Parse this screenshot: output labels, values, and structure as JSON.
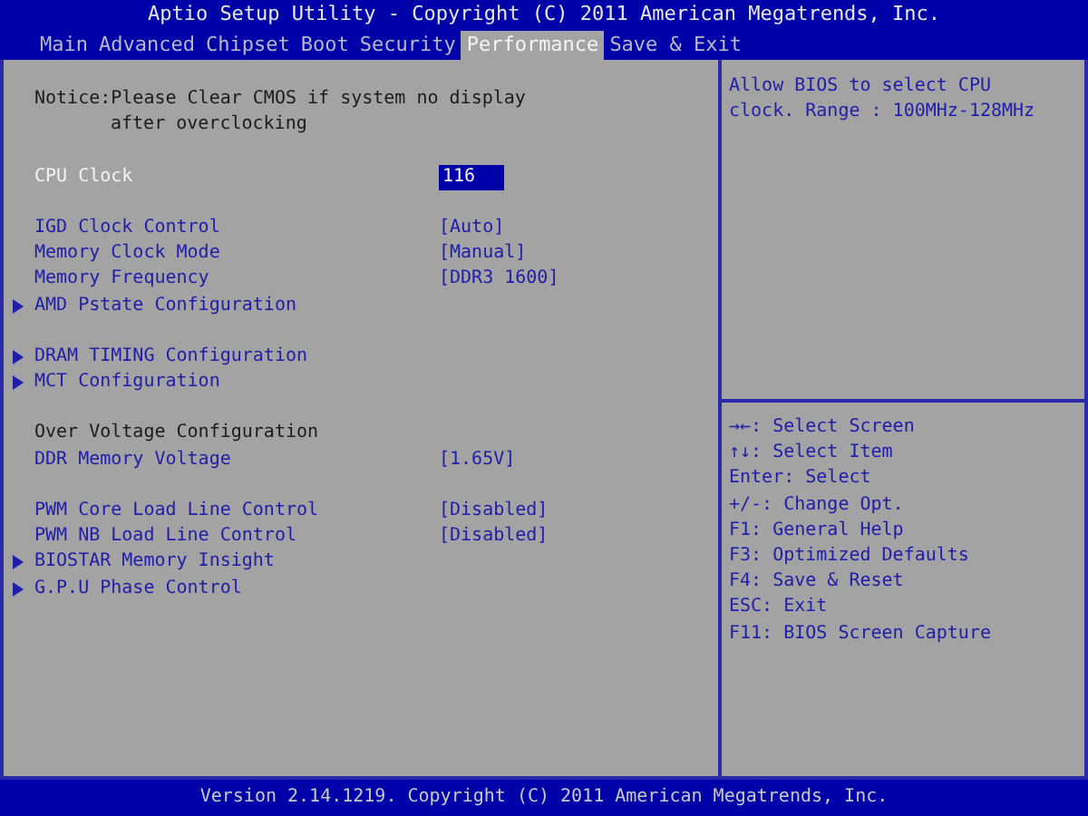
{
  "title": "Aptio Setup Utility - Copyright (C) 2011 American Megatrends, Inc.",
  "tabs": [
    {
      "label": "Main",
      "selected": false
    },
    {
      "label": "Advanced",
      "selected": false
    },
    {
      "label": "Chipset",
      "selected": false
    },
    {
      "label": "Boot",
      "selected": false
    },
    {
      "label": "Security",
      "selected": false
    },
    {
      "label": "Performance",
      "selected": true
    },
    {
      "label": "Save & Exit",
      "selected": false
    }
  ],
  "sections": [
    {
      "items": [
        {
          "kind": "notice",
          "lines": [
            "Notice:Please Clear CMOS if system no display",
            "after overclocking"
          ]
        }
      ]
    },
    {
      "items": [
        {
          "kind": "setting",
          "label": "CPU Clock",
          "value": "116",
          "selected": true
        }
      ]
    },
    {
      "items": [
        {
          "kind": "setting",
          "label": "IGD Clock Control",
          "value": "[Auto]",
          "selected": false
        },
        {
          "kind": "setting",
          "label": "Memory Clock Mode",
          "value": "[Manual]",
          "selected": false
        },
        {
          "kind": "setting",
          "label": "Memory Frequency",
          "value": "[DDR3 1600]",
          "selected": false
        },
        {
          "kind": "submenu",
          "label": "AMD Pstate Configuration",
          "selected": false
        }
      ]
    },
    {
      "items": [
        {
          "kind": "submenu",
          "label": "DRAM TIMING Configuration",
          "selected": false
        },
        {
          "kind": "submenu",
          "label": "MCT Configuration",
          "selected": false
        }
      ]
    },
    {
      "items": [
        {
          "kind": "heading",
          "label": "Over Voltage Configuration"
        },
        {
          "kind": "setting",
          "label": "DDR Memory Voltage",
          "value": "[1.65V]",
          "selected": false
        }
      ]
    },
    {
      "items": [
        {
          "kind": "setting",
          "label": "PWM Core Load Line Control",
          "value": "[Disabled]",
          "selected": false
        },
        {
          "kind": "setting",
          "label": "PWM NB Load Line Control",
          "value": "[Disabled]",
          "selected": false
        },
        {
          "kind": "submenu",
          "label": "BIOSTAR Memory Insight",
          "selected": false
        },
        {
          "kind": "submenu",
          "label": "G.P.U Phase Control",
          "selected": false
        }
      ]
    }
  ],
  "help_text": [
    "Allow BIOS to select CPU",
    "clock. Range : 100MHz-128MHz"
  ],
  "key_help": [
    "→←: Select Screen",
    "↑↓: Select Item",
    "Enter: Select",
    "+/-: Change Opt.",
    "F1: General Help",
    "F3: Optimized Defaults",
    "F4: Save & Reset",
    "ESC: Exit",
    "F11: BIOS Screen Capture"
  ],
  "footer": "Version 2.14.1219. Copyright (C) 2011 American Megatrends, Inc."
}
